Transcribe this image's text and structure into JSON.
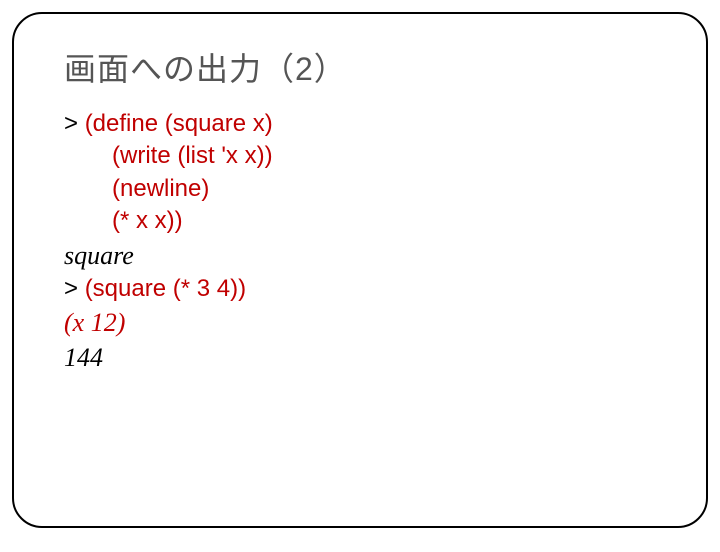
{
  "title": "画面への出力（2）",
  "lines": {
    "l1a": "> ",
    "l1b": "(define (square x)",
    "l2": "(write (list 'x x))",
    "l3": "(newline)",
    "l4": "(* x x))",
    "l5": "square",
    "l6a": "> ",
    "l6b": "(square (* 3 4))",
    "l7": "(x 12)",
    "l8": "144"
  }
}
